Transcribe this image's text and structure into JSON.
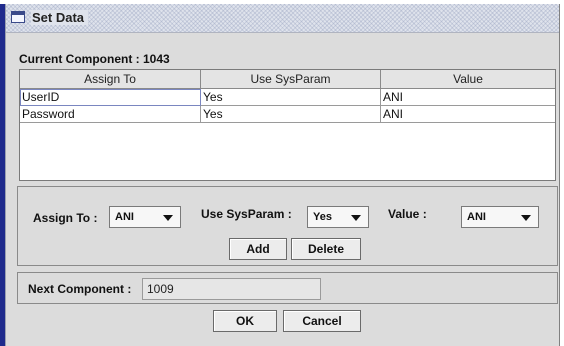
{
  "window": {
    "title": "Set Data"
  },
  "current_component": {
    "label": "Current Component :",
    "value": "1043"
  },
  "table": {
    "columns": [
      "Assign To",
      "Use SysParam",
      "Value"
    ],
    "rows": [
      [
        "UserID",
        "Yes",
        "ANI"
      ],
      [
        "Password",
        "Yes",
        "ANI"
      ]
    ]
  },
  "form": {
    "assign_to": {
      "label": "Assign To :",
      "value": "ANI"
    },
    "use_sysparam": {
      "label": "Use SysParam :",
      "value": "Yes"
    },
    "value": {
      "label": "Value :",
      "value": "ANI"
    },
    "add_label": "Add",
    "delete_label": "Delete"
  },
  "next_component": {
    "label": "Next Component :",
    "value": "1009"
  },
  "buttons": {
    "ok": "OK",
    "cancel": "Cancel"
  }
}
